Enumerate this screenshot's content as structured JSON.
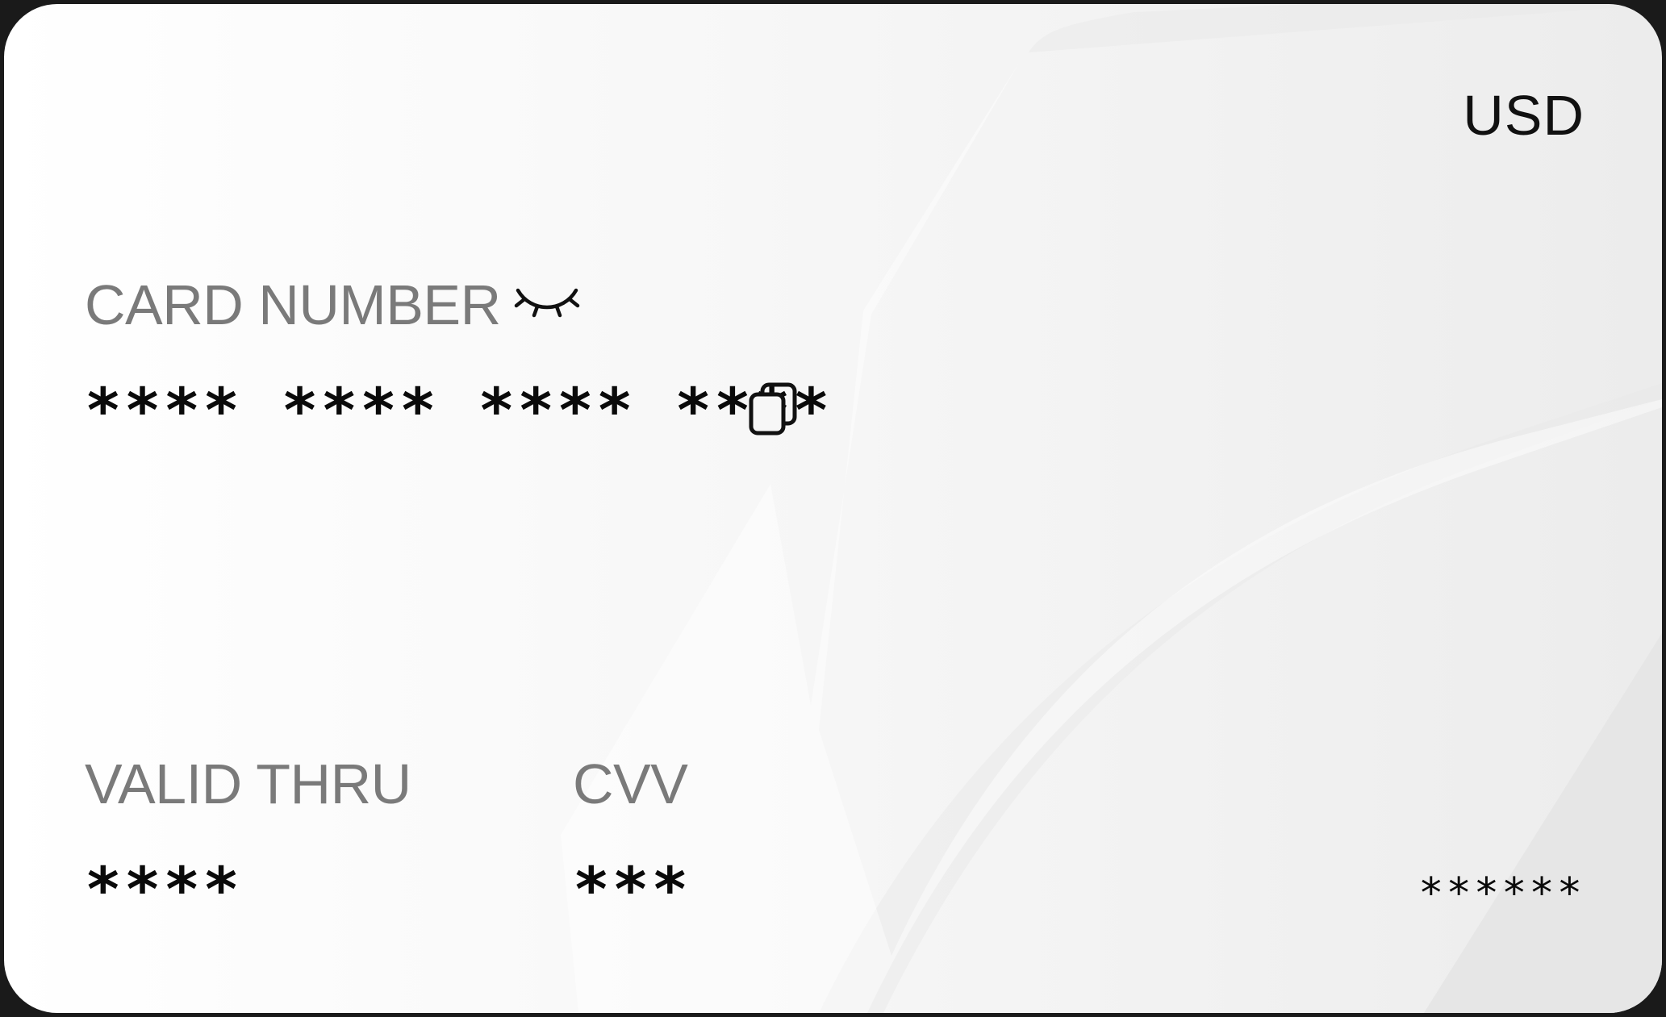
{
  "card": {
    "currency": "USD",
    "card_number_label": "CARD NUMBER",
    "card_number_masked": "**** **** **** ****",
    "valid_thru_label": "VALID THRU",
    "valid_thru_masked": "****",
    "cvv_label": "CVV",
    "cvv_masked": "***",
    "extra_masked": "******",
    "icons": {
      "visibility_toggle": "eye-closed-icon",
      "copy": "copy-icon"
    },
    "colors": {
      "label": "#7a7a7a",
      "value": "#0a0a0a",
      "background": "#f5f5f5"
    }
  }
}
